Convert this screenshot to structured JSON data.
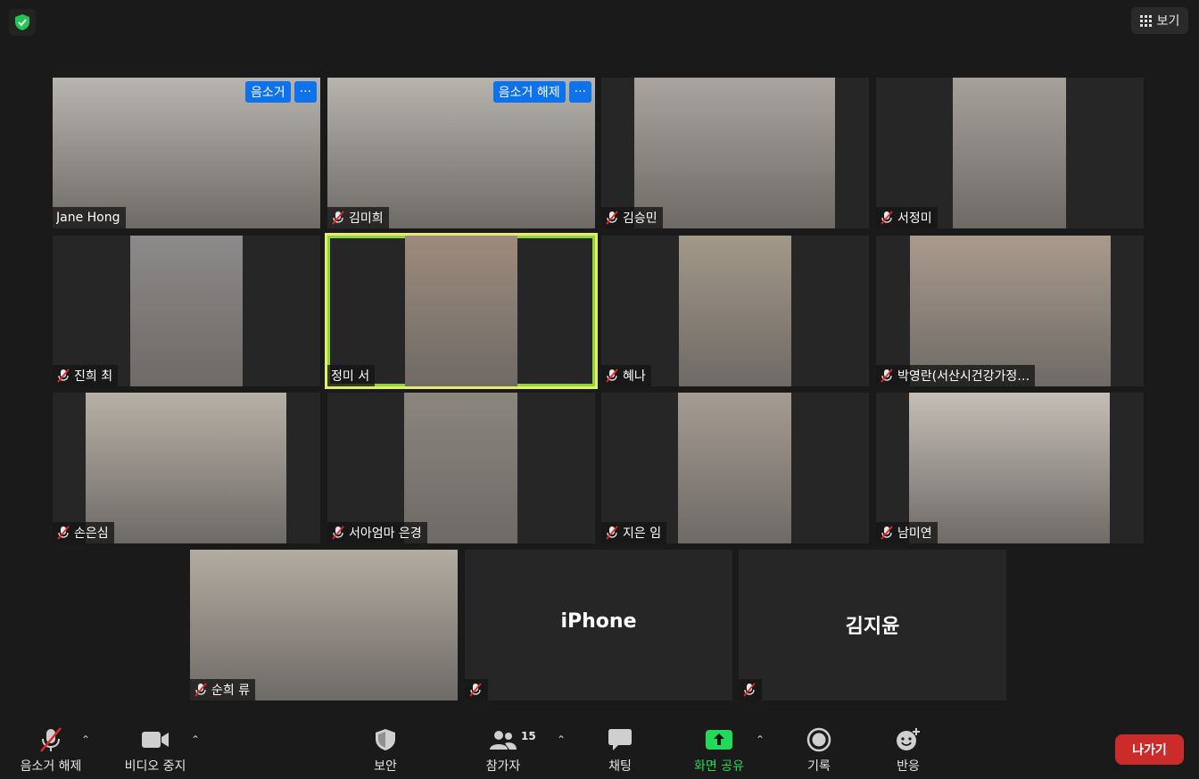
{
  "top": {
    "view_label": "보기"
  },
  "tiles": [
    {
      "name": "Jane Hong",
      "muted": false,
      "hover": [
        "음소거",
        "···"
      ],
      "video": "#b8b4b0"
    },
    {
      "name": "김미희",
      "muted": true,
      "hover": [
        "음소거 해제",
        "···"
      ],
      "video": "#b7b3ad"
    },
    {
      "name": "김승민",
      "muted": true,
      "video": "#a9a49f"
    },
    {
      "name": "서정미",
      "muted": true,
      "video": "#a6a09a"
    },
    {
      "name": "진희 최",
      "muted": true,
      "video": "#8c8a8a"
    },
    {
      "name": "정미 서",
      "muted": false,
      "active": true,
      "video": "#9e8b7c"
    },
    {
      "name": "혜나",
      "muted": true,
      "video": "#a39888"
    },
    {
      "name": "박영란(서산시건강가정…",
      "muted": true,
      "video": "#a99a8c"
    },
    {
      "name": "손은심",
      "muted": true,
      "video": "#b7b0a6"
    },
    {
      "name": "서아엄마 은경",
      "muted": true,
      "video": "#8a857d"
    },
    {
      "name": "지은 임",
      "muted": true,
      "video": "#a59b92"
    },
    {
      "name": "남미연",
      "muted": true,
      "video": "#c4beb6"
    },
    {
      "name": "순희 류",
      "muted": true,
      "video": "#b3aca1"
    },
    {
      "name": "",
      "big": "iPhone",
      "muted": true
    },
    {
      "name": "",
      "big": "김지윤",
      "muted": true
    }
  ],
  "toolbar": {
    "unmute": "음소거 해제",
    "stop_video": "비디오 중지",
    "security": "보안",
    "participants": "참가자",
    "participants_count": "15",
    "chat": "채팅",
    "share_screen": "화면 공유",
    "record": "기록",
    "reactions": "반응",
    "leave": "나가기"
  },
  "colors": {
    "share_green": "#23d959",
    "leave_red": "#cc2b2b",
    "host_blue": "#0e72ed",
    "active_speaker": "#e6eb6e"
  }
}
